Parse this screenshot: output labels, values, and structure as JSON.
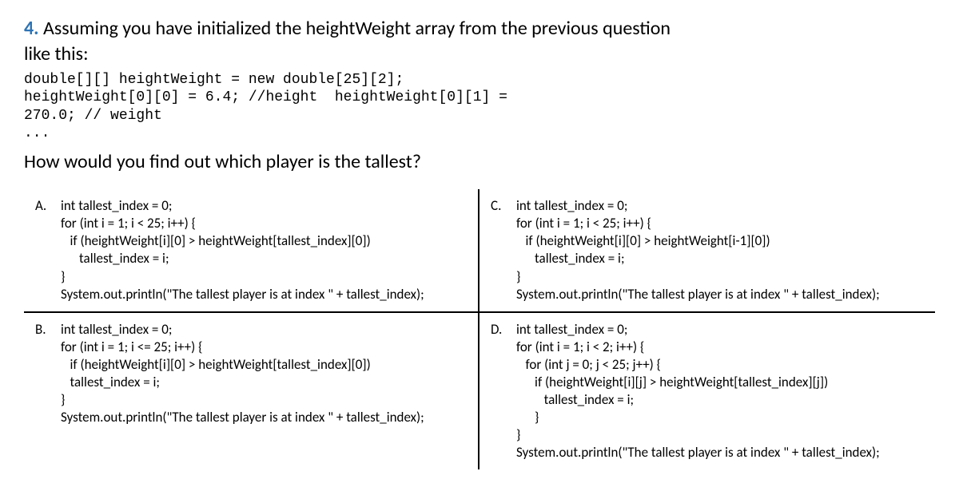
{
  "qnum": "4.",
  "prompt_line1_after": " Assuming you have initialized the heightWeight array from the previous question",
  "prompt_line2": "like this:",
  "code_line1": "double[][] heightWeight = new double[25][2];",
  "code_line2": "heightWeight[0][0] = 6.4; //height  heightWeight[0][1] =",
  "code_line3": "270.0; // weight",
  "code_line4": "...",
  "question2": "How would you find out which player is the tallest?",
  "options": {
    "A": {
      "letter": "A.",
      "text": "int tallest_index = 0;\nfor (int i = 1; i < 25; i++) {\n   if (heightWeight[i][0] > heightWeight[tallest_index][0])\n      tallest_index = i;\n}\nSystem.out.println(\"The tallest player is at index \" + tallest_index);"
    },
    "B": {
      "letter": "B.",
      "text": "int tallest_index = 0;\nfor (int i = 1; i <= 25; i++) {\n   if (heightWeight[i][0] > heightWeight[tallest_index][0])\n   tallest_index = i;\n}\nSystem.out.println(\"The tallest player is at index \" + tallest_index);"
    },
    "C": {
      "letter": "C.",
      "text": "int tallest_index = 0;\nfor (int i = 1; i < 25; i++) {\n   if (heightWeight[i][0] > heightWeight[i-1][0])\n      tallest_index = i;\n}\nSystem.out.println(\"The tallest player is at index \" + tallest_index);"
    },
    "D": {
      "letter": "D.",
      "text": "int tallest_index = 0;\nfor (int i = 1; i < 2; i++) {\n   for (int j = 0; j < 25; j++) {\n      if (heightWeight[i][j] > heightWeight[tallest_index][j])\n         tallest_index = i;\n      }\n}\nSystem.out.println(\"The tallest player is at index \" + tallest_index);"
    }
  }
}
